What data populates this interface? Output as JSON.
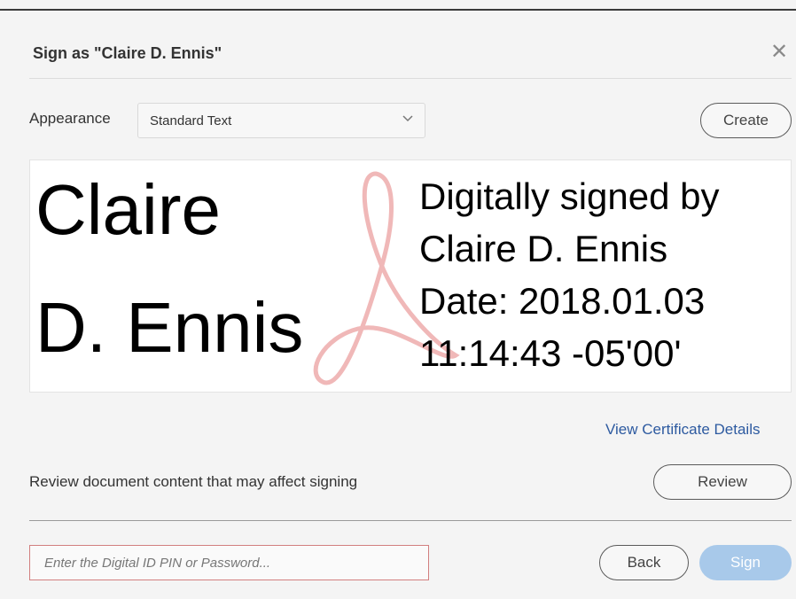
{
  "dialog": {
    "title": "Sign as \"Claire D. Ennis\"",
    "close_icon": "close-icon"
  },
  "appearance": {
    "label": "Appearance",
    "selected": "Standard Text",
    "create_label": "Create"
  },
  "signature_preview": {
    "name_line1": "Claire",
    "name_line2": "D. Ennis",
    "details": [
      "Digitally signed by",
      "Claire D. Ennis",
      "Date: 2018.01.03",
      "11:14:43 -05'00'"
    ],
    "watermark_icon": "acrobat-logo-icon"
  },
  "certificate": {
    "link_label": "View Certificate Details"
  },
  "review": {
    "text": "Review document content that may affect signing",
    "button_label": "Review"
  },
  "footer": {
    "pin_placeholder": "Enter the Digital ID PIN or Password...",
    "pin_value": "",
    "back_label": "Back",
    "sign_label": "Sign"
  },
  "colors": {
    "link": "#2d5aa0",
    "sign_button": "#a8c9ea",
    "pin_border": "#d27f7f",
    "watermark": "#f0b8b8"
  }
}
